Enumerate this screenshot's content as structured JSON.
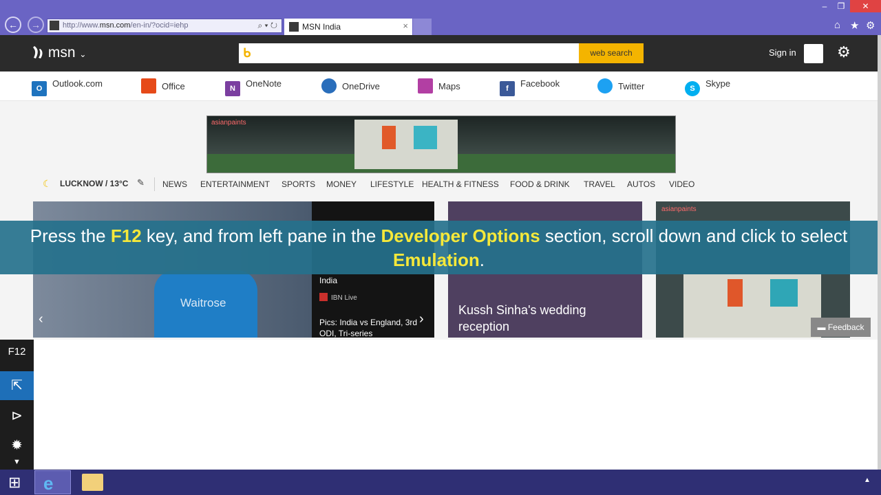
{
  "browser": {
    "url_prefix": "http://www.",
    "url_domain": "msn.com",
    "url_rest": "/en-in/?ocid=iehp",
    "tab_title": "MSN India",
    "tab_close": "×",
    "back_icon": "back-arrow-icon",
    "forward_icon": "forward-arrow-icon"
  },
  "msn": {
    "logo": "msn",
    "search_button": "web search",
    "signin": "Sign in"
  },
  "apps": [
    {
      "label": "Outlook.com",
      "color": "#1e73be",
      "glyph": "O"
    },
    {
      "label": "Office",
      "color": "#e64a19",
      "glyph": ""
    },
    {
      "label": "OneNote",
      "color": "#7b3fa0",
      "glyph": "N"
    },
    {
      "label": "OneDrive",
      "color": "#2a6ebb",
      "glyph": ""
    },
    {
      "label": "Maps",
      "color": "#b23fa3",
      "glyph": ""
    },
    {
      "label": "Facebook",
      "color": "#3b5998",
      "glyph": "f"
    },
    {
      "label": "Twitter",
      "color": "#1da1f2",
      "glyph": ""
    },
    {
      "label": "Skype",
      "color": "#00aff0",
      "glyph": "S"
    }
  ],
  "weather": "LUCKNOW / 13°C",
  "categories": [
    "NEWS",
    "ENTERTAINMENT",
    "SPORTS",
    "MONEY",
    "LIFESTYLE",
    "HEALTH & FITNESS",
    "FOOD & DRINK",
    "TRAVEL",
    "AUTOS",
    "VIDEO"
  ],
  "ad": {
    "brand": "asianpaints"
  },
  "cards": {
    "c1_line1": "India",
    "c1_source": "IBN Live",
    "c1_line2": "Pics: India vs England, 3rd ODI, Tri-series",
    "c1_shirt": "Waitrose",
    "c2_title": "Kussh Sinha's wedding reception",
    "c3_brand": "asianpaints"
  },
  "feedback": "Feedback",
  "caption": {
    "t1": "Press the ",
    "h1": "F12",
    "t2": " key, and from left pane in the ",
    "h2": "Developer Options",
    "t3": " section, scroll down and click to select ",
    "h3": "Emulation",
    "t4": "."
  },
  "devtools": {
    "label": "F12"
  }
}
